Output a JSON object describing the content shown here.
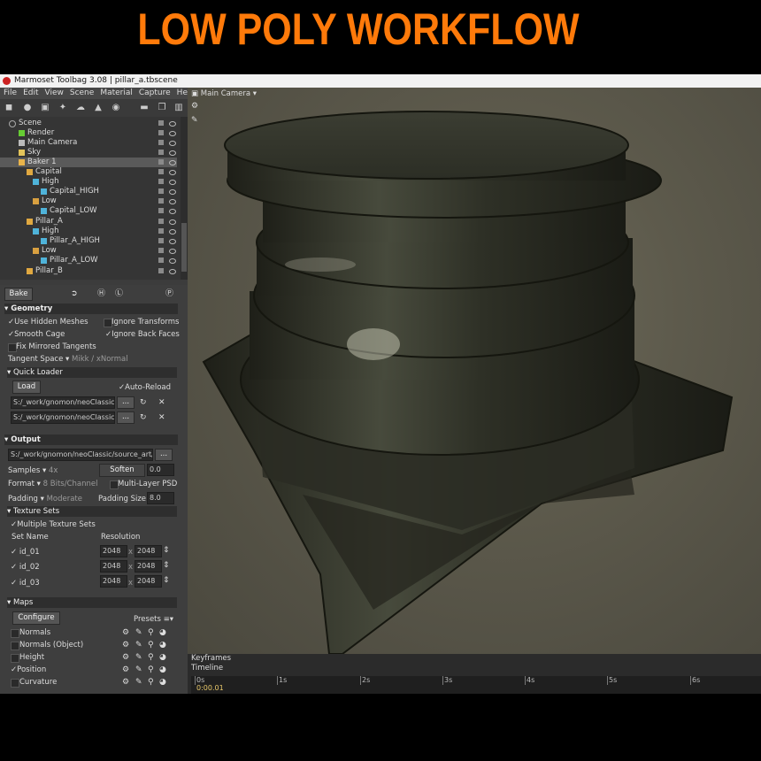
{
  "banner": {
    "title": "LOW POLY WORKFLOW",
    "color": "#ff7a0a"
  },
  "window": {
    "title": "Marmoset Toolbag 3.08  |  pillar_a.tbscene"
  },
  "menu": [
    "File",
    "Edit",
    "View",
    "Scene",
    "Material",
    "Capture",
    "Help"
  ],
  "toolbar_icons": [
    "cube-icon",
    "light-icon",
    "camera-icon",
    "tool-icon",
    "cloud-icon",
    "hat-icon",
    "sphere-icon",
    "folder-icon",
    "copy-icon",
    "trash-icon"
  ],
  "tree": {
    "items": [
      {
        "label": "Scene",
        "icon": "scene-icon"
      },
      {
        "label": "Render",
        "icon": "render-icon"
      },
      {
        "label": "Main Camera",
        "icon": "camera-icon"
      },
      {
        "label": "Sky",
        "icon": "sky-icon"
      },
      {
        "label": "Baker 1",
        "icon": "baker-icon",
        "selected": true
      },
      {
        "label": "Capital",
        "icon": "folder-icon"
      },
      {
        "label": "High",
        "icon": "mesh-group-icon"
      },
      {
        "label": "Capital_HIGH",
        "icon": "mesh-icon"
      },
      {
        "label": "Low",
        "icon": "mesh-group-icon"
      },
      {
        "label": "Capital_LOW",
        "icon": "mesh-icon"
      },
      {
        "label": "Pillar_A",
        "icon": "folder-icon"
      },
      {
        "label": "High",
        "icon": "mesh-group-icon"
      },
      {
        "label": "Pillar_A_HIGH",
        "icon": "mesh-icon"
      },
      {
        "label": "Low",
        "icon": "mesh-group-icon"
      },
      {
        "label": "Pillar_A_LOW",
        "icon": "mesh-icon"
      },
      {
        "label": "Pillar_B",
        "icon": "folder-icon"
      }
    ]
  },
  "bake": {
    "bake_button": "Bake",
    "geometry": {
      "header": "Geometry",
      "use_hidden_meshes": "Use Hidden Meshes",
      "ignore_transforms": "Ignore Transforms",
      "smooth_cage": "Smooth Cage",
      "ignore_back_faces": "Ignore Back Faces",
      "fix_mirrored_tangents": "Fix Mirrored Tangents",
      "tangent_space_label": "Tangent Space",
      "tangent_space_value": "Mikk / xNormal"
    },
    "quick_loader": {
      "header": "Quick Loader",
      "load_button": "Load",
      "auto_reload": "Auto-Reload",
      "path1": "S:/_work/gnomon/neoClassic",
      "path2": "S:/_work/gnomon/neoClassic",
      "more": "..."
    },
    "output": {
      "header": "Output",
      "path": "S:/_work/gnomon/neoClassic/source_art/j",
      "more": "...",
      "samples_label": "Samples",
      "samples_value": "4x",
      "soften_label": "Soften",
      "soften_value": "0.0",
      "format_label": "Format",
      "format_value": "8 Bits/Channel",
      "multi_layer": "Multi-Layer PSD",
      "padding_label": "Padding",
      "padding_value": "Moderate",
      "padding_size_label": "Padding Size:",
      "padding_size_value": "8.0"
    },
    "texture_sets": {
      "header": "Texture Sets",
      "multiple": "Multiple Texture Sets",
      "col_set": "Set Name",
      "col_res": "Resolution",
      "rows": [
        {
          "name": "id_01",
          "w": "2048",
          "h": "2048"
        },
        {
          "name": "id_02",
          "w": "2048",
          "h": "2048"
        },
        {
          "name": "id_03",
          "w": "2048",
          "h": "2048"
        }
      ],
      "x": "x"
    },
    "maps": {
      "header": "Maps",
      "configure": "Configure",
      "presets": "Presets",
      "items": [
        {
          "label": "Normals",
          "checked": false
        },
        {
          "label": "Normals (Object)",
          "checked": false
        },
        {
          "label": "Height",
          "checked": false
        },
        {
          "label": "Position",
          "checked": true
        },
        {
          "label": "Curvature",
          "checked": false
        }
      ]
    }
  },
  "viewport": {
    "camera": "Main Camera"
  },
  "timeline": {
    "keyframes": "Keyframes",
    "timeline": "Timeline",
    "ticks": [
      "0s",
      "1s",
      "2s",
      "3s",
      "4s",
      "5s",
      "6s"
    ],
    "current": "0:00.01"
  }
}
